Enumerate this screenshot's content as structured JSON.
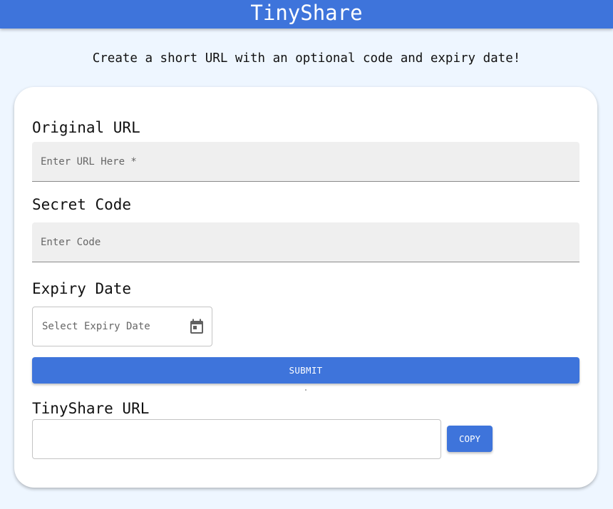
{
  "app": {
    "title": "TinyShare",
    "tagline": "Create a short URL with an optional code and expiry date!"
  },
  "form": {
    "url_label": "Original URL",
    "url_placeholder": "Enter URL Here *",
    "url_value": "",
    "code_label": "Secret Code",
    "code_placeholder": "Enter Code",
    "code_value": "",
    "expiry_label": "Expiry Date",
    "expiry_placeholder": "Select Expiry Date",
    "expiry_icon": "calendar-icon",
    "submit_label": "SUBMIT"
  },
  "result": {
    "label": "TinyShare URL",
    "value": "",
    "copy_label": "COPY"
  },
  "colors": {
    "primary": "#3e74db",
    "background": "#eef6ff",
    "card": "#ffffff",
    "field_fill": "#efefef"
  }
}
